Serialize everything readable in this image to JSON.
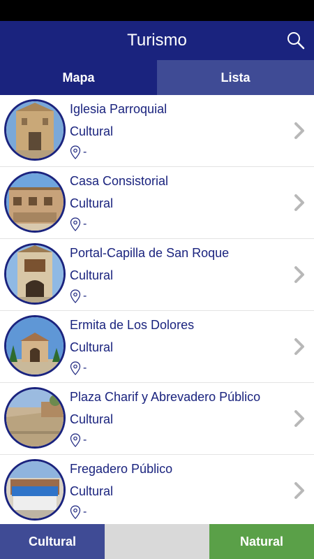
{
  "header": {
    "title": "Turismo",
    "search_icon": "search-icon"
  },
  "tabs": [
    {
      "label": "Mapa",
      "active": true
    },
    {
      "label": "Lista",
      "active": false
    }
  ],
  "colors": {
    "primary": "#1a237e",
    "tab_inactive": "#3f4b95",
    "natural": "#5aa048",
    "neutral": "#d9d9d9"
  },
  "items": [
    {
      "title": "Iglesia Parroquial",
      "category": "Cultural",
      "location": "-"
    },
    {
      "title": "Casa Consistorial",
      "category": "Cultural",
      "location": "-"
    },
    {
      "title": "Portal-Capilla de San Roque",
      "category": "Cultural",
      "location": "-"
    },
    {
      "title": "Ermita de Los Dolores",
      "category": "Cultural",
      "location": "-"
    },
    {
      "title": "Plaza Charif y Abrevadero Público",
      "category": "Cultural",
      "location": "-"
    },
    {
      "title": "Fregadero Público",
      "category": "Cultural",
      "location": "-"
    }
  ],
  "filters": {
    "cultural": "Cultural",
    "middle": "",
    "natural": "Natural"
  }
}
